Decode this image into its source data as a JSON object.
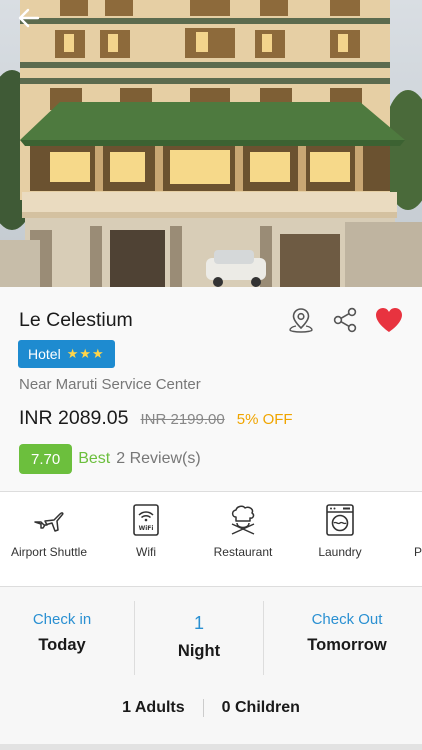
{
  "hotel": {
    "name": "Le Celestium",
    "type": "Hotel",
    "stars": "★★★",
    "address": "Near Maruti Service Center",
    "price": "INR 2089.05",
    "original_price": "INR 2199.00",
    "discount": "5% OFF",
    "rating_score": "7.70",
    "rating_label": "Best",
    "reviews": "2 Review(s)"
  },
  "amenities": [
    {
      "label": "Airport Shuttle",
      "icon": "airplane-icon"
    },
    {
      "label": "Wifi",
      "icon": "wifi-icon"
    },
    {
      "label": "Restaurant",
      "icon": "chef-icon"
    },
    {
      "label": "Laundry",
      "icon": "washing-machine-icon"
    },
    {
      "label": "P",
      "icon": "parking-icon"
    }
  ],
  "booking": {
    "check_in_label": "Check in",
    "check_in_value": "Today",
    "nights_count": "1",
    "nights_label": "Night",
    "check_out_label": "Check Out",
    "check_out_value": "Tomorrow",
    "adults": "1 Adults",
    "children": "0 Children"
  },
  "colors": {
    "accent_blue": "#1e8bd0",
    "rating_green": "#6cbf3d",
    "discount_orange": "#f0a500",
    "favorite_red": "#e8333f"
  }
}
